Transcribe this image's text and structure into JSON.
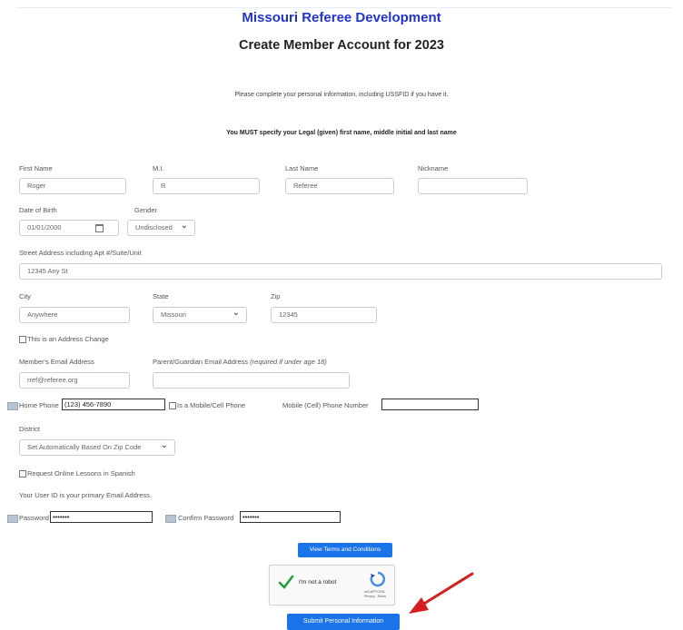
{
  "header": {
    "title": "Missouri Referee Development",
    "page_heading": "Create Member Account for 2023"
  },
  "intro": {
    "text": "Please complete your personal information, including USSFID if you have it.",
    "legal_notice": "You MUST specify your Legal (given) first name, middle initial and last name"
  },
  "form": {
    "first_name": {
      "label": "First Name",
      "value": "Roger"
    },
    "mi": {
      "label": "M.I.",
      "value": "R"
    },
    "last_name": {
      "label": "Last Name",
      "value": "Referee"
    },
    "nickname": {
      "label": "Nickname",
      "value": ""
    },
    "dob": {
      "label": "Date of Birth",
      "value": "01/01/2000"
    },
    "gender": {
      "label": "Gender",
      "value": "Undisclosed"
    },
    "street": {
      "label": "Street Address including Apt #/Suite/Unit",
      "value": "12345 Any St"
    },
    "city": {
      "label": "City",
      "value": "Anywhere"
    },
    "state": {
      "label": "State",
      "value": "Missouri"
    },
    "zip": {
      "label": "Zip",
      "value": "12345"
    },
    "address_change": {
      "label": "This is an Address Change",
      "checked": false
    },
    "email": {
      "label": "Member's Email Address",
      "value": "rref@referee.org"
    },
    "guardian_email": {
      "label": "Parent/Guardian Email Address",
      "note": "(required if under age 18)",
      "value": ""
    },
    "home_phone": {
      "label": "Home Phone",
      "value": "(123) 456-7890"
    },
    "is_mobile": {
      "label": "Is a Mobile/Cell Phone",
      "checked": false
    },
    "mobile_phone": {
      "label": "Mobile (Cell) Phone Number",
      "value": ""
    },
    "district": {
      "label": "District",
      "value": "Set Automatically Based On Zip Code"
    },
    "spanish": {
      "label": "Request Online Lessons in Spanish",
      "checked": false
    },
    "user_id_note": "Your User ID is your primary Email Address.",
    "password": {
      "label": "Password",
      "value": "•••••••"
    },
    "confirm_password": {
      "label": "Confirm Password",
      "value": "•••••••"
    }
  },
  "buttons": {
    "terms": "View Terms and Conditions",
    "submit": "Submit Personal Information"
  },
  "recaptcha": {
    "label": "I'm not a robot",
    "brand": "reCAPTCHA",
    "links": "Privacy - Terms"
  },
  "colors": {
    "title": "#2233cc",
    "button": "#1a73e8",
    "arrow": "#d42020",
    "check": "#1e9e3c"
  }
}
